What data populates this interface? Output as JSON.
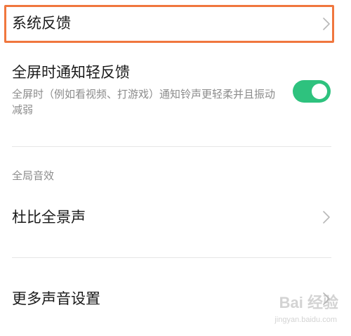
{
  "rows": {
    "system_feedback": {
      "title": "系统反馈"
    },
    "fullscreen_notify": {
      "title": "全屏时通知轻反馈",
      "description": "全屏时（例如看视频、打游戏）通知铃声更轻柔并且振动减弱",
      "toggle_on": true
    },
    "global_sound_section": "全局音效",
    "dolby": {
      "title": "杜比全景声"
    },
    "more_sound": {
      "title": "更多声音设置"
    }
  },
  "watermark": {
    "main": "Bai 经验",
    "sub": "jingyan.baidu.com"
  },
  "colors": {
    "highlight_border": "#f0773e",
    "toggle_on": "#2ec27e",
    "text_primary": "#1a1a1a",
    "text_secondary": "#8c8c8c",
    "divider": "#e6e6e6"
  },
  "icons": {
    "chevron": "chevron-right-icon",
    "toggle": "toggle-switch"
  }
}
